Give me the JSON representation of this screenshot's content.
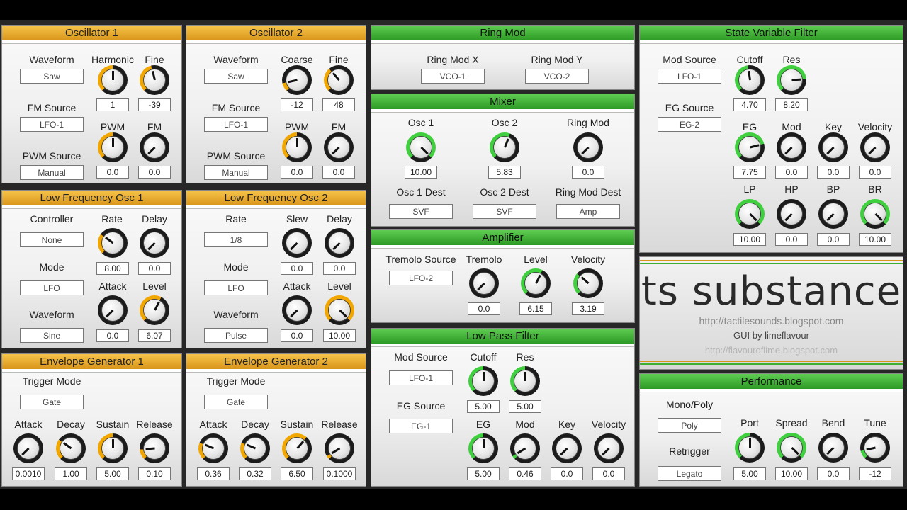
{
  "colors": {
    "orange": "#f2a600",
    "green": "#3fcf3f",
    "header_orange": "#e4aa33",
    "header_green": "#3fb034"
  },
  "osc1": {
    "title": "Oscillator 1",
    "waveform_label": "Waveform",
    "waveform": "Saw",
    "harmonic_label": "Harmonic",
    "fine_label": "Fine",
    "harmonic": "1",
    "fine": "-39",
    "fm_source_label": "FM Source",
    "fm_source": "LFO-1",
    "pwm_label": "PWM",
    "fm_label": "FM",
    "pwm_source_label": "PWM Source",
    "pwm_source": "Manual",
    "pwm": "0.0",
    "fm": "0.0"
  },
  "osc2": {
    "title": "Oscillator 2",
    "waveform_label": "Waveform",
    "waveform": "Saw",
    "coarse_label": "Coarse",
    "fine_label": "Fine",
    "coarse": "-12",
    "fine": "48",
    "fm_source_label": "FM Source",
    "fm_source": "LFO-1",
    "pwm_label": "PWM",
    "fm_label": "FM",
    "pwm_source_label": "PWM Source",
    "pwm_source": "Manual",
    "pwm": "0.0",
    "fm": "0.0"
  },
  "lfo1": {
    "title": "Low Frequency Osc 1",
    "controller_label": "Controller",
    "controller": "None",
    "rate_label": "Rate",
    "delay_label": "Delay",
    "rate": "8.00",
    "delay": "0.0",
    "mode_label": "Mode",
    "mode": "LFO",
    "attack_label": "Attack",
    "level_label": "Level",
    "waveform_label": "Waveform",
    "waveform": "Sine",
    "attack": "0.0",
    "level": "6.07"
  },
  "lfo2": {
    "title": "Low Frequency Osc 2",
    "rate_label": "Rate",
    "rate": "1/8",
    "slew_label": "Slew",
    "delay_label": "Delay",
    "slew": "0.0",
    "delay": "0.0",
    "mode_label": "Mode",
    "mode": "LFO",
    "attack_label": "Attack",
    "level_label": "Level",
    "waveform_label": "Waveform",
    "waveform": "Pulse",
    "attack": "0.0",
    "level": "10.00"
  },
  "eg1": {
    "title": "Envelope Generator 1",
    "trigger_label": "Trigger Mode",
    "trigger": "Gate",
    "attack_label": "Attack",
    "decay_label": "Decay",
    "sustain_label": "Sustain",
    "release_label": "Release",
    "attack": "0.0010",
    "decay": "1.00",
    "sustain": "5.00",
    "release": "0.10"
  },
  "eg2": {
    "title": "Envelope Generator 2",
    "trigger_label": "Trigger Mode",
    "trigger": "Gate",
    "attack_label": "Attack",
    "decay_label": "Decay",
    "sustain_label": "Sustain",
    "release_label": "Release",
    "attack": "0.36",
    "decay": "0.32",
    "sustain": "6.50",
    "release": "0.1000"
  },
  "ringmod": {
    "title": "Ring Mod",
    "x_label": "Ring Mod X",
    "x": "VCO-1",
    "y_label": "Ring Mod Y",
    "y": "VCO-2"
  },
  "mixer": {
    "title": "Mixer",
    "osc1_label": "Osc 1",
    "osc2_label": "Osc 2",
    "ring_label": "Ring Mod",
    "osc1": "10.00",
    "osc2": "5.83",
    "ring": "0.0",
    "osc1_dest_label": "Osc 1 Dest",
    "osc1_dest": "SVF",
    "osc2_dest_label": "Osc 2 Dest",
    "osc2_dest": "SVF",
    "ring_dest_label": "Ring Mod Dest",
    "ring_dest": "Amp"
  },
  "amp": {
    "title": "Amplifier",
    "tremolo_source_label": "Tremolo Source",
    "tremolo_source": "LFO-2",
    "tremolo_label": "Tremolo",
    "level_label": "Level",
    "velocity_label": "Velocity",
    "tremolo": "0.0",
    "level": "6.15",
    "velocity": "3.19"
  },
  "lpf": {
    "title": "Low Pass Filter",
    "mod_source_label": "Mod Source",
    "mod_source": "LFO-1",
    "cutoff_label": "Cutoff",
    "res_label": "Res",
    "cutoff": "5.00",
    "res": "5.00",
    "eg_source_label": "EG Source",
    "eg_source": "EG-1",
    "eg_label": "EG",
    "mod_label": "Mod",
    "key_label": "Key",
    "velocity_label": "Velocity",
    "eg": "5.00",
    "mod": "0.46",
    "key": "0.0",
    "velocity": "0.0"
  },
  "svf": {
    "title": "State Variable Filter",
    "mod_source_label": "Mod Source",
    "mod_source": "LFO-1",
    "cutoff_label": "Cutoff",
    "res_label": "Res",
    "cutoff": "4.70",
    "res": "8.20",
    "eg_source_label": "EG Source",
    "eg_source": "EG-2",
    "eg_label": "EG",
    "mod_label": "Mod",
    "key_label": "Key",
    "velocity_label": "Velocity",
    "eg": "7.75",
    "mod": "0.0",
    "key": "0.0",
    "velocity": "0.0",
    "lp_label": "LP",
    "hp_label": "HP",
    "bp_label": "BP",
    "br_label": "BR",
    "lp": "10.00",
    "hp": "0.0",
    "bp": "0.0",
    "br": "10.00"
  },
  "branding": {
    "logo": "ts substance",
    "url1": "http://tactilesounds.blogspot.com",
    "credit": "GUI by limeflavour",
    "url2": "http://flavouroflime.blogspot.com"
  },
  "performance": {
    "title": "Performance",
    "monopoly_label": "Mono/Poly",
    "monopoly": "Poly",
    "retrigger_label": "Retrigger",
    "retrigger": "Legato",
    "port_label": "Port",
    "spread_label": "Spread",
    "bend_label": "Bend",
    "tune_label": "Tune",
    "port": "5.00",
    "spread": "10.00",
    "bend": "0.0",
    "tune": "-12"
  },
  "knob_levels": {
    "osc1_harmonic": 0.5,
    "osc1_fine": 0.45,
    "osc1_pwm": 0.5,
    "osc1_fm": 0.0,
    "osc2_coarse": 0.12,
    "osc2_fine": 0.35,
    "osc2_pwm": 0.5,
    "osc2_fm": 0.0,
    "lfo1_rate": 0.3,
    "lfo1_delay": 0.0,
    "lfo1_attack": 0.0,
    "lfo1_level": 0.6,
    "lfo2_slew": 0.0,
    "lfo2_delay": 0.0,
    "lfo2_attack": 0.0,
    "lfo2_level": 1.0,
    "eg1_attack": 0.0,
    "eg1_decay": 0.3,
    "eg1_sustain": 0.5,
    "eg1_release": 0.15,
    "eg2_attack": 0.25,
    "eg2_decay": 0.25,
    "eg2_sustain": 0.65,
    "eg2_release": 0.05,
    "mixer_osc1": 1.0,
    "mixer_osc2": 0.58,
    "mixer_ring": 0.0,
    "amp_tremolo": 0.0,
    "amp_level": 0.6,
    "amp_velocity": 0.32,
    "lpf_cutoff": 0.5,
    "lpf_res": 0.5,
    "lpf_eg": 0.5,
    "lpf_mod": 0.05,
    "lpf_key": 0.0,
    "lpf_velocity": 0.0,
    "svf_cutoff": 0.47,
    "svf_res": 0.82,
    "svf_eg": 0.78,
    "svf_mod": 0.0,
    "svf_key": 0.0,
    "svf_velocity": 0.0,
    "svf_lp": 1.0,
    "svf_hp": 0.0,
    "svf_bp": 0.0,
    "svf_br": 1.0,
    "perf_port": 0.5,
    "perf_spread": 1.0,
    "perf_bend": 0.0,
    "perf_tune": 0.12
  }
}
